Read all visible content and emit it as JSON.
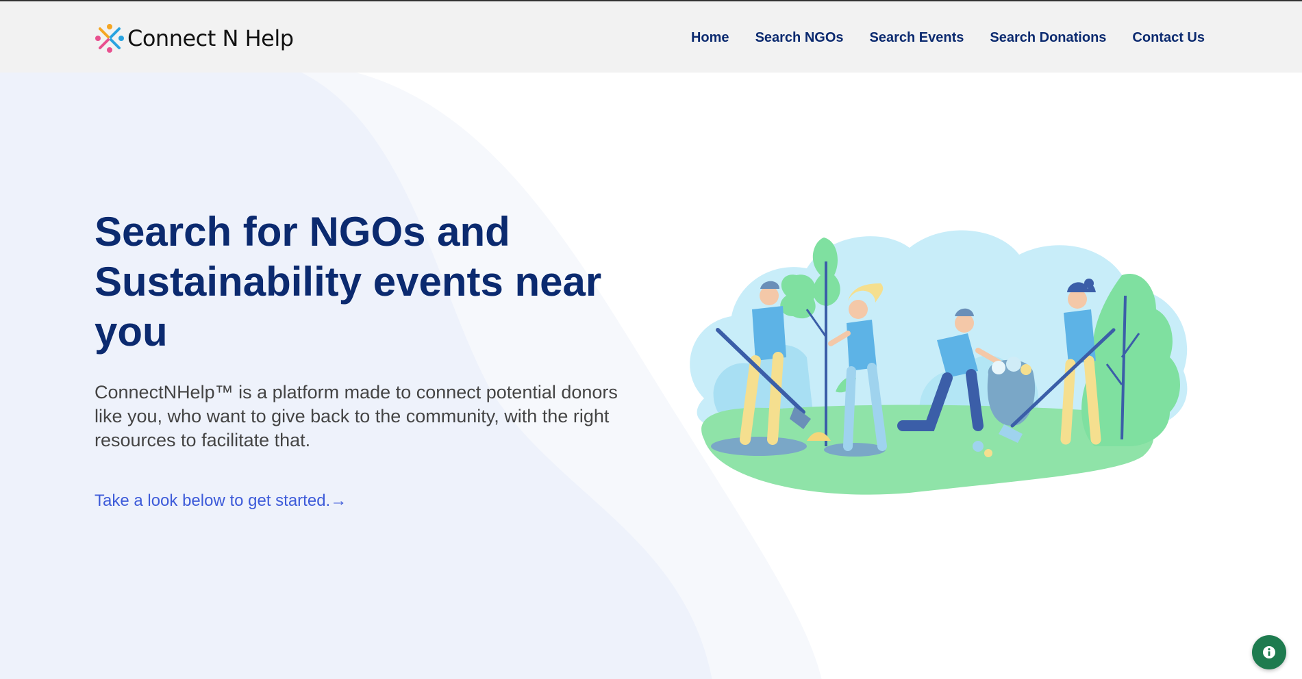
{
  "brand": {
    "name": "Connect N Help"
  },
  "nav": {
    "home": "Home",
    "search_ngos": "Search NGOs",
    "search_events": "Search Events",
    "search_donations": "Search Donations",
    "contact_us": "Contact Us"
  },
  "hero": {
    "title": "Search for NGOs and Sustainability events near you",
    "description": "ConnectNHelp™ is a platform made to connect potential donors like you, who want to give back to the community, with the right resources to facilitate that.",
    "cta": "Take a look below to get started.→"
  },
  "icons": {
    "info": "info-icon",
    "logo": "connect-n-help-logo"
  },
  "colors": {
    "header_bg": "#f2f2f2",
    "heading": "#0b2a6f",
    "link": "#3d5bd9",
    "info_button": "#1e7b4f"
  }
}
